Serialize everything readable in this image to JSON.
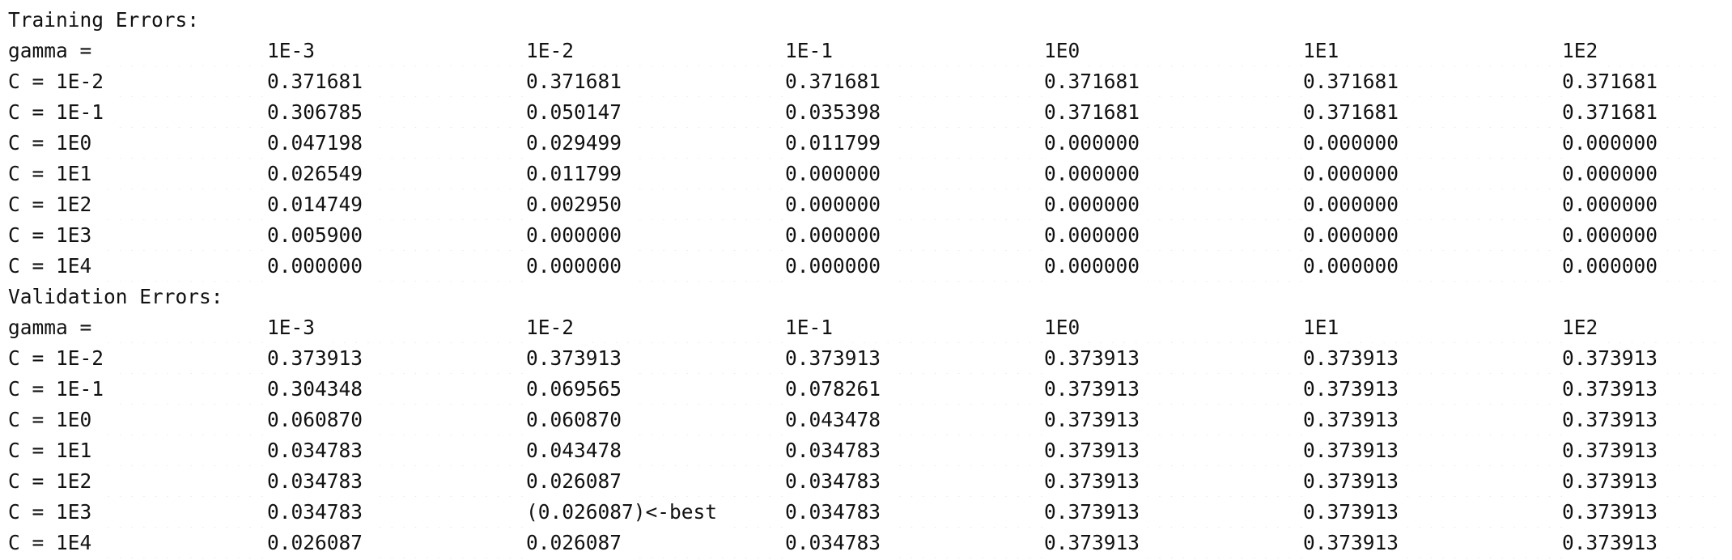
{
  "training": {
    "heading": "Training Errors:",
    "gamma_label": "gamma =",
    "gamma_values": [
      "1E-3",
      "1E-2",
      "1E-1",
      "1E0",
      "1E1",
      "1E2"
    ],
    "rows": [
      {
        "label": "C = 1E-2",
        "values": [
          "0.371681",
          "0.371681",
          "0.371681",
          "0.371681",
          "0.371681",
          "0.371681"
        ]
      },
      {
        "label": "C = 1E-1",
        "values": [
          "0.306785",
          "0.050147",
          "0.035398",
          "0.371681",
          "0.371681",
          "0.371681"
        ]
      },
      {
        "label": "C = 1E0",
        "values": [
          "0.047198",
          "0.029499",
          "0.011799",
          "0.000000",
          "0.000000",
          "0.000000"
        ]
      },
      {
        "label": "C = 1E1",
        "values": [
          "0.026549",
          "0.011799",
          "0.000000",
          "0.000000",
          "0.000000",
          "0.000000"
        ]
      },
      {
        "label": "C = 1E2",
        "values": [
          "0.014749",
          "0.002950",
          "0.000000",
          "0.000000",
          "0.000000",
          "0.000000"
        ]
      },
      {
        "label": "C = 1E3",
        "values": [
          "0.005900",
          "0.000000",
          "0.000000",
          "0.000000",
          "0.000000",
          "0.000000"
        ]
      },
      {
        "label": "C = 1E4",
        "values": [
          "0.000000",
          "0.000000",
          "0.000000",
          "0.000000",
          "0.000000",
          "0.000000"
        ]
      }
    ]
  },
  "validation": {
    "heading": "Validation Errors:",
    "gamma_label": "gamma =",
    "gamma_values": [
      "1E-3",
      "1E-2",
      "1E-1",
      "1E0",
      "1E1",
      "1E2"
    ],
    "rows": [
      {
        "label": "C = 1E-2",
        "values": [
          "0.373913",
          "0.373913",
          "0.373913",
          "0.373913",
          "0.373913",
          "0.373913"
        ]
      },
      {
        "label": "C = 1E-1",
        "values": [
          "0.304348",
          "0.069565",
          "0.078261",
          "0.373913",
          "0.373913",
          "0.373913"
        ]
      },
      {
        "label": "C = 1E0",
        "values": [
          "0.060870",
          "0.060870",
          "0.043478",
          "0.373913",
          "0.373913",
          "0.373913"
        ]
      },
      {
        "label": "C = 1E1",
        "values": [
          "0.034783",
          "0.043478",
          "0.034783",
          "0.373913",
          "0.373913",
          "0.373913"
        ]
      },
      {
        "label": "C = 1E2",
        "values": [
          "0.034783",
          "0.026087",
          "0.034783",
          "0.373913",
          "0.373913",
          "0.373913"
        ]
      },
      {
        "label": "C = 1E3",
        "values": [
          "0.034783",
          "(0.026087)<-best",
          "0.034783",
          "0.373913",
          "0.373913",
          "0.373913"
        ]
      },
      {
        "label": "C = 1E4",
        "values": [
          "0.026087",
          "0.026087",
          "0.034783",
          "0.373913",
          "0.373913",
          "0.373913"
        ]
      }
    ]
  }
}
